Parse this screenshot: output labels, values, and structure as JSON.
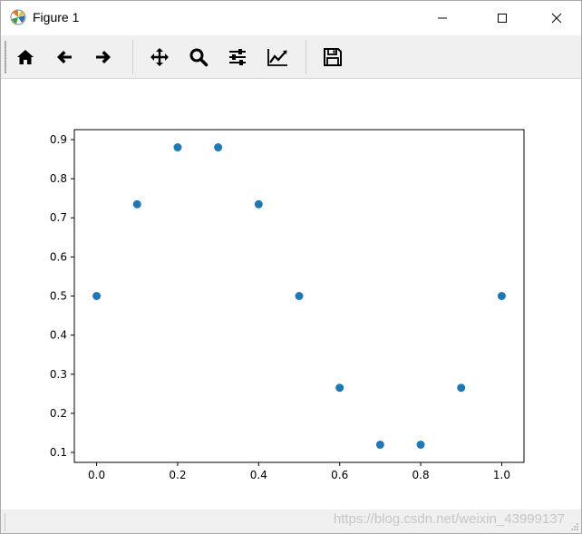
{
  "window": {
    "title": "Figure 1",
    "controls": {
      "minimize": "minimize",
      "maximize": "maximize",
      "close": "close"
    }
  },
  "toolbar": {
    "buttons": [
      {
        "id": "home",
        "icon": "home-icon"
      },
      {
        "id": "back",
        "icon": "arrow-left-icon"
      },
      {
        "id": "forward",
        "icon": "arrow-right-icon"
      },
      {
        "id": "pan",
        "icon": "move-icon"
      },
      {
        "id": "zoom",
        "icon": "magnifier-icon"
      },
      {
        "id": "configure",
        "icon": "sliders-icon"
      },
      {
        "id": "edit",
        "icon": "line-chart-icon"
      },
      {
        "id": "save",
        "icon": "floppy-disk-icon"
      }
    ]
  },
  "statusbar": {
    "watermark": "https://blog.csdn.net/weixin_43999137"
  },
  "chart_data": {
    "type": "scatter",
    "x": [
      0.0,
      0.1,
      0.2,
      0.3,
      0.4,
      0.5,
      0.6,
      0.7,
      0.8,
      0.9,
      1.0
    ],
    "y": [
      0.5,
      0.7347,
      0.8802,
      0.8802,
      0.7347,
      0.5,
      0.2653,
      0.1198,
      0.1198,
      0.2653,
      0.5
    ],
    "xticks": [
      "0.0",
      "0.2",
      "0.4",
      "0.6",
      "0.8",
      "1.0"
    ],
    "xtick_values": [
      0.0,
      0.2,
      0.4,
      0.6,
      0.8,
      1.0
    ],
    "yticks": [
      "0.1",
      "0.2",
      "0.3",
      "0.4",
      "0.5",
      "0.6",
      "0.7",
      "0.8",
      "0.9"
    ],
    "ytick_values": [
      0.1,
      0.2,
      0.3,
      0.4,
      0.5,
      0.6,
      0.7,
      0.8,
      0.9
    ],
    "xlim": [
      -0.055,
      1.055
    ],
    "ylim": [
      0.0745,
      0.9255
    ],
    "grid": false,
    "marker_color": "#1f77b4",
    "title": "",
    "xlabel": "",
    "ylabel": ""
  }
}
